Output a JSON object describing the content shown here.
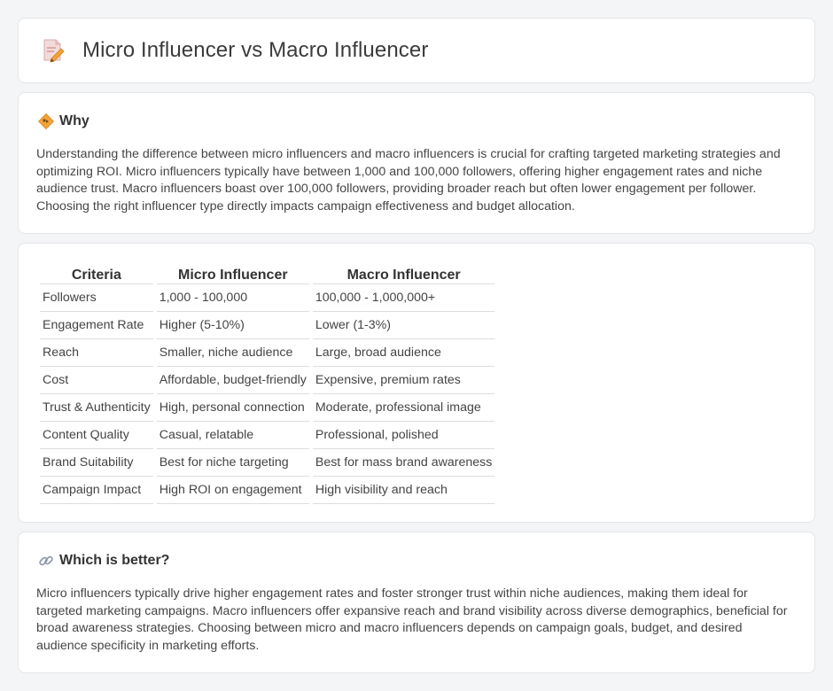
{
  "header": {
    "title": "Micro Influencer vs Macro Influencer",
    "icon": "document-pencil-icon"
  },
  "why": {
    "title": "Why",
    "icon": "diamond-sign-icon",
    "text": "Understanding the difference between micro influencers and macro influencers is crucial for crafting targeted marketing strategies and optimizing ROI. Micro influencers typically have between 1,000 and 100,000 followers, offering higher engagement rates and niche audience trust. Macro influencers boast over 100,000 followers, providing broader reach but often lower engagement per follower. Choosing the right influencer type directly impacts campaign effectiveness and budget allocation."
  },
  "comparison": {
    "headers": [
      "Criteria",
      "Micro Influencer",
      "Macro Influencer"
    ],
    "rows": [
      [
        "Followers",
        "1,000 - 100,000",
        "100,000 - 1,000,000+"
      ],
      [
        "Engagement Rate",
        "Higher (5-10%)",
        "Lower (1-3%)"
      ],
      [
        "Reach",
        "Smaller, niche audience",
        "Large, broad audience"
      ],
      [
        "Cost",
        "Affordable, budget-friendly",
        "Expensive, premium rates"
      ],
      [
        "Trust & Authenticity",
        "High, personal connection",
        "Moderate, professional image"
      ],
      [
        "Content Quality",
        "Casual, relatable",
        "Professional, polished"
      ],
      [
        "Brand Suitability",
        "Best for niche targeting",
        "Best for mass brand awareness"
      ],
      [
        "Campaign Impact",
        "High ROI on engagement",
        "High visibility and reach"
      ]
    ]
  },
  "better": {
    "title": "Which is better?",
    "icon": "link-icon",
    "text": "Micro influencers typically drive higher engagement rates and foster stronger trust within niche audiences, making them ideal for targeted marketing campaigns. Macro influencers offer expansive reach and brand visibility across diverse demographics, beneficial for broad awareness strategies. Choosing between micro and macro influencers depends on campaign goals, budget, and desired audience specificity in marketing efforts."
  },
  "colors": {
    "background": "#f4f5f7",
    "card": "#ffffff",
    "accent_orange": "#f0a030"
  }
}
